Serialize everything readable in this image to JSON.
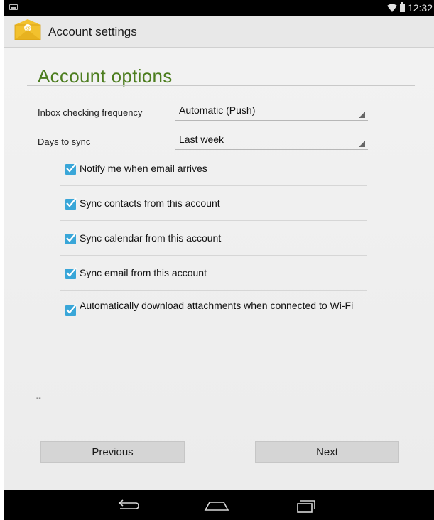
{
  "status_bar": {
    "time": "12:32"
  },
  "action_bar": {
    "title": "Account settings",
    "app_icon": "email-app-icon"
  },
  "section": {
    "title": "Account options"
  },
  "fields": [
    {
      "label": "Inbox checking frequency",
      "value": "Automatic (Push)"
    },
    {
      "label": "Days to sync",
      "value": "Last week"
    }
  ],
  "checkboxes": [
    {
      "label": "Notify me when email arrives",
      "checked": true
    },
    {
      "label": "Sync contacts from this account",
      "checked": true
    },
    {
      "label": "Sync calendar from this account",
      "checked": true
    },
    {
      "label": "Sync email from this account",
      "checked": true
    },
    {
      "label": "Automatically download attachments when connected to Wi-Fi",
      "checked": true
    }
  ],
  "footnote": "--",
  "buttons": {
    "previous": "Previous",
    "next": "Next"
  },
  "nav_bar": {
    "icons": [
      "back-icon",
      "home-icon",
      "recent-apps-icon"
    ]
  },
  "colors": {
    "accent": "#39a6d8",
    "section_title": "#4c7d1e"
  }
}
